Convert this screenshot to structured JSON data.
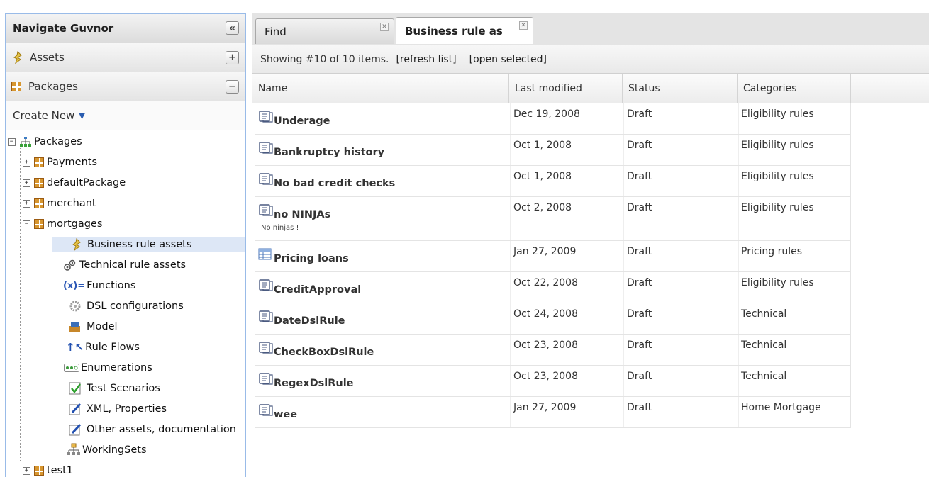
{
  "nav": {
    "title": "Navigate Guvnor",
    "collapse_glyph": "«",
    "assets": {
      "label": "Assets",
      "btn": "+"
    },
    "packages": {
      "label": "Packages",
      "btn": "−"
    },
    "create_new": "Create New",
    "tree": {
      "root": "Packages",
      "items": [
        {
          "label": "Payments",
          "expander": "+"
        },
        {
          "label": "defaultPackage",
          "expander": "+"
        },
        {
          "label": "merchant",
          "expander": "+"
        },
        {
          "label": "mortgages",
          "expander": "−"
        }
      ],
      "children": [
        {
          "label": "Business rule assets",
          "icon": "business-rule-icon",
          "selected": true
        },
        {
          "label": "Technical rule assets",
          "icon": "gears-icon"
        },
        {
          "label": "Functions",
          "icon": "function-icon"
        },
        {
          "label": "DSL configurations",
          "icon": "dsl-gear-icon"
        },
        {
          "label": "Model",
          "icon": "model-icon"
        },
        {
          "label": "Rule Flows",
          "icon": "ruleflow-icon"
        },
        {
          "label": "Enumerations",
          "icon": "enumeration-icon"
        },
        {
          "label": "Test Scenarios",
          "icon": "test-scenario-icon"
        },
        {
          "label": "XML, Properties",
          "icon": "edit-icon"
        },
        {
          "label": "Other assets, documentation",
          "icon": "edit-icon"
        },
        {
          "label": "WorkingSets",
          "icon": "workingsets-icon"
        }
      ],
      "after": [
        {
          "label": "test1",
          "expander": "+"
        }
      ]
    }
  },
  "tabs": [
    {
      "label": "Find",
      "active": false
    },
    {
      "label": "Business rule as",
      "active": true
    }
  ],
  "toolbar": {
    "showing": "Showing #10 of 10 items.",
    "refresh": "[refresh list]",
    "open": "[open selected]"
  },
  "columns": [
    "Name",
    "Last modified",
    "Status",
    "Categories"
  ],
  "rows": [
    {
      "name": "Underage",
      "date": "Dec 19, 2008",
      "status": "Draft",
      "category": "Eligibility rules",
      "icon": "rule-icon",
      "desc": ""
    },
    {
      "name": "Bankruptcy history",
      "date": "Oct 1, 2008",
      "status": "Draft",
      "category": "Eligibility rules",
      "icon": "rule-icon",
      "desc": ""
    },
    {
      "name": "No bad credit checks",
      "date": "Oct 1, 2008",
      "status": "Draft",
      "category": "Eligibility rules",
      "icon": "rule-icon",
      "desc": ""
    },
    {
      "name": "no NINJAs",
      "date": "Oct 2, 2008",
      "status": "Draft",
      "category": "Eligibility rules",
      "icon": "rule-icon",
      "desc": "No ninjas !"
    },
    {
      "name": "Pricing loans",
      "date": "Jan 27, 2009",
      "status": "Draft",
      "category": "Pricing rules",
      "icon": "decision-table-icon",
      "desc": ""
    },
    {
      "name": "CreditApproval",
      "date": "Oct 22, 2008",
      "status": "Draft",
      "category": "Eligibility rules",
      "icon": "rule-icon",
      "desc": ""
    },
    {
      "name": "DateDslRule",
      "date": "Oct 24, 2008",
      "status": "Draft",
      "category": "Technical",
      "icon": "rule-icon",
      "desc": ""
    },
    {
      "name": "CheckBoxDslRule",
      "date": "Oct 23, 2008",
      "status": "Draft",
      "category": "Technical",
      "icon": "rule-icon",
      "desc": ""
    },
    {
      "name": "RegexDslRule",
      "date": "Oct 23, 2008",
      "status": "Draft",
      "category": "Technical",
      "icon": "rule-icon",
      "desc": ""
    },
    {
      "name": "wee",
      "date": "Jan 27, 2009",
      "status": "Draft",
      "category": "Home Mortgage",
      "icon": "rule-icon",
      "desc": ""
    }
  ],
  "colors": {
    "accent": "#99bbe8",
    "selected": "#dde7f6",
    "package": "#d7962f"
  }
}
